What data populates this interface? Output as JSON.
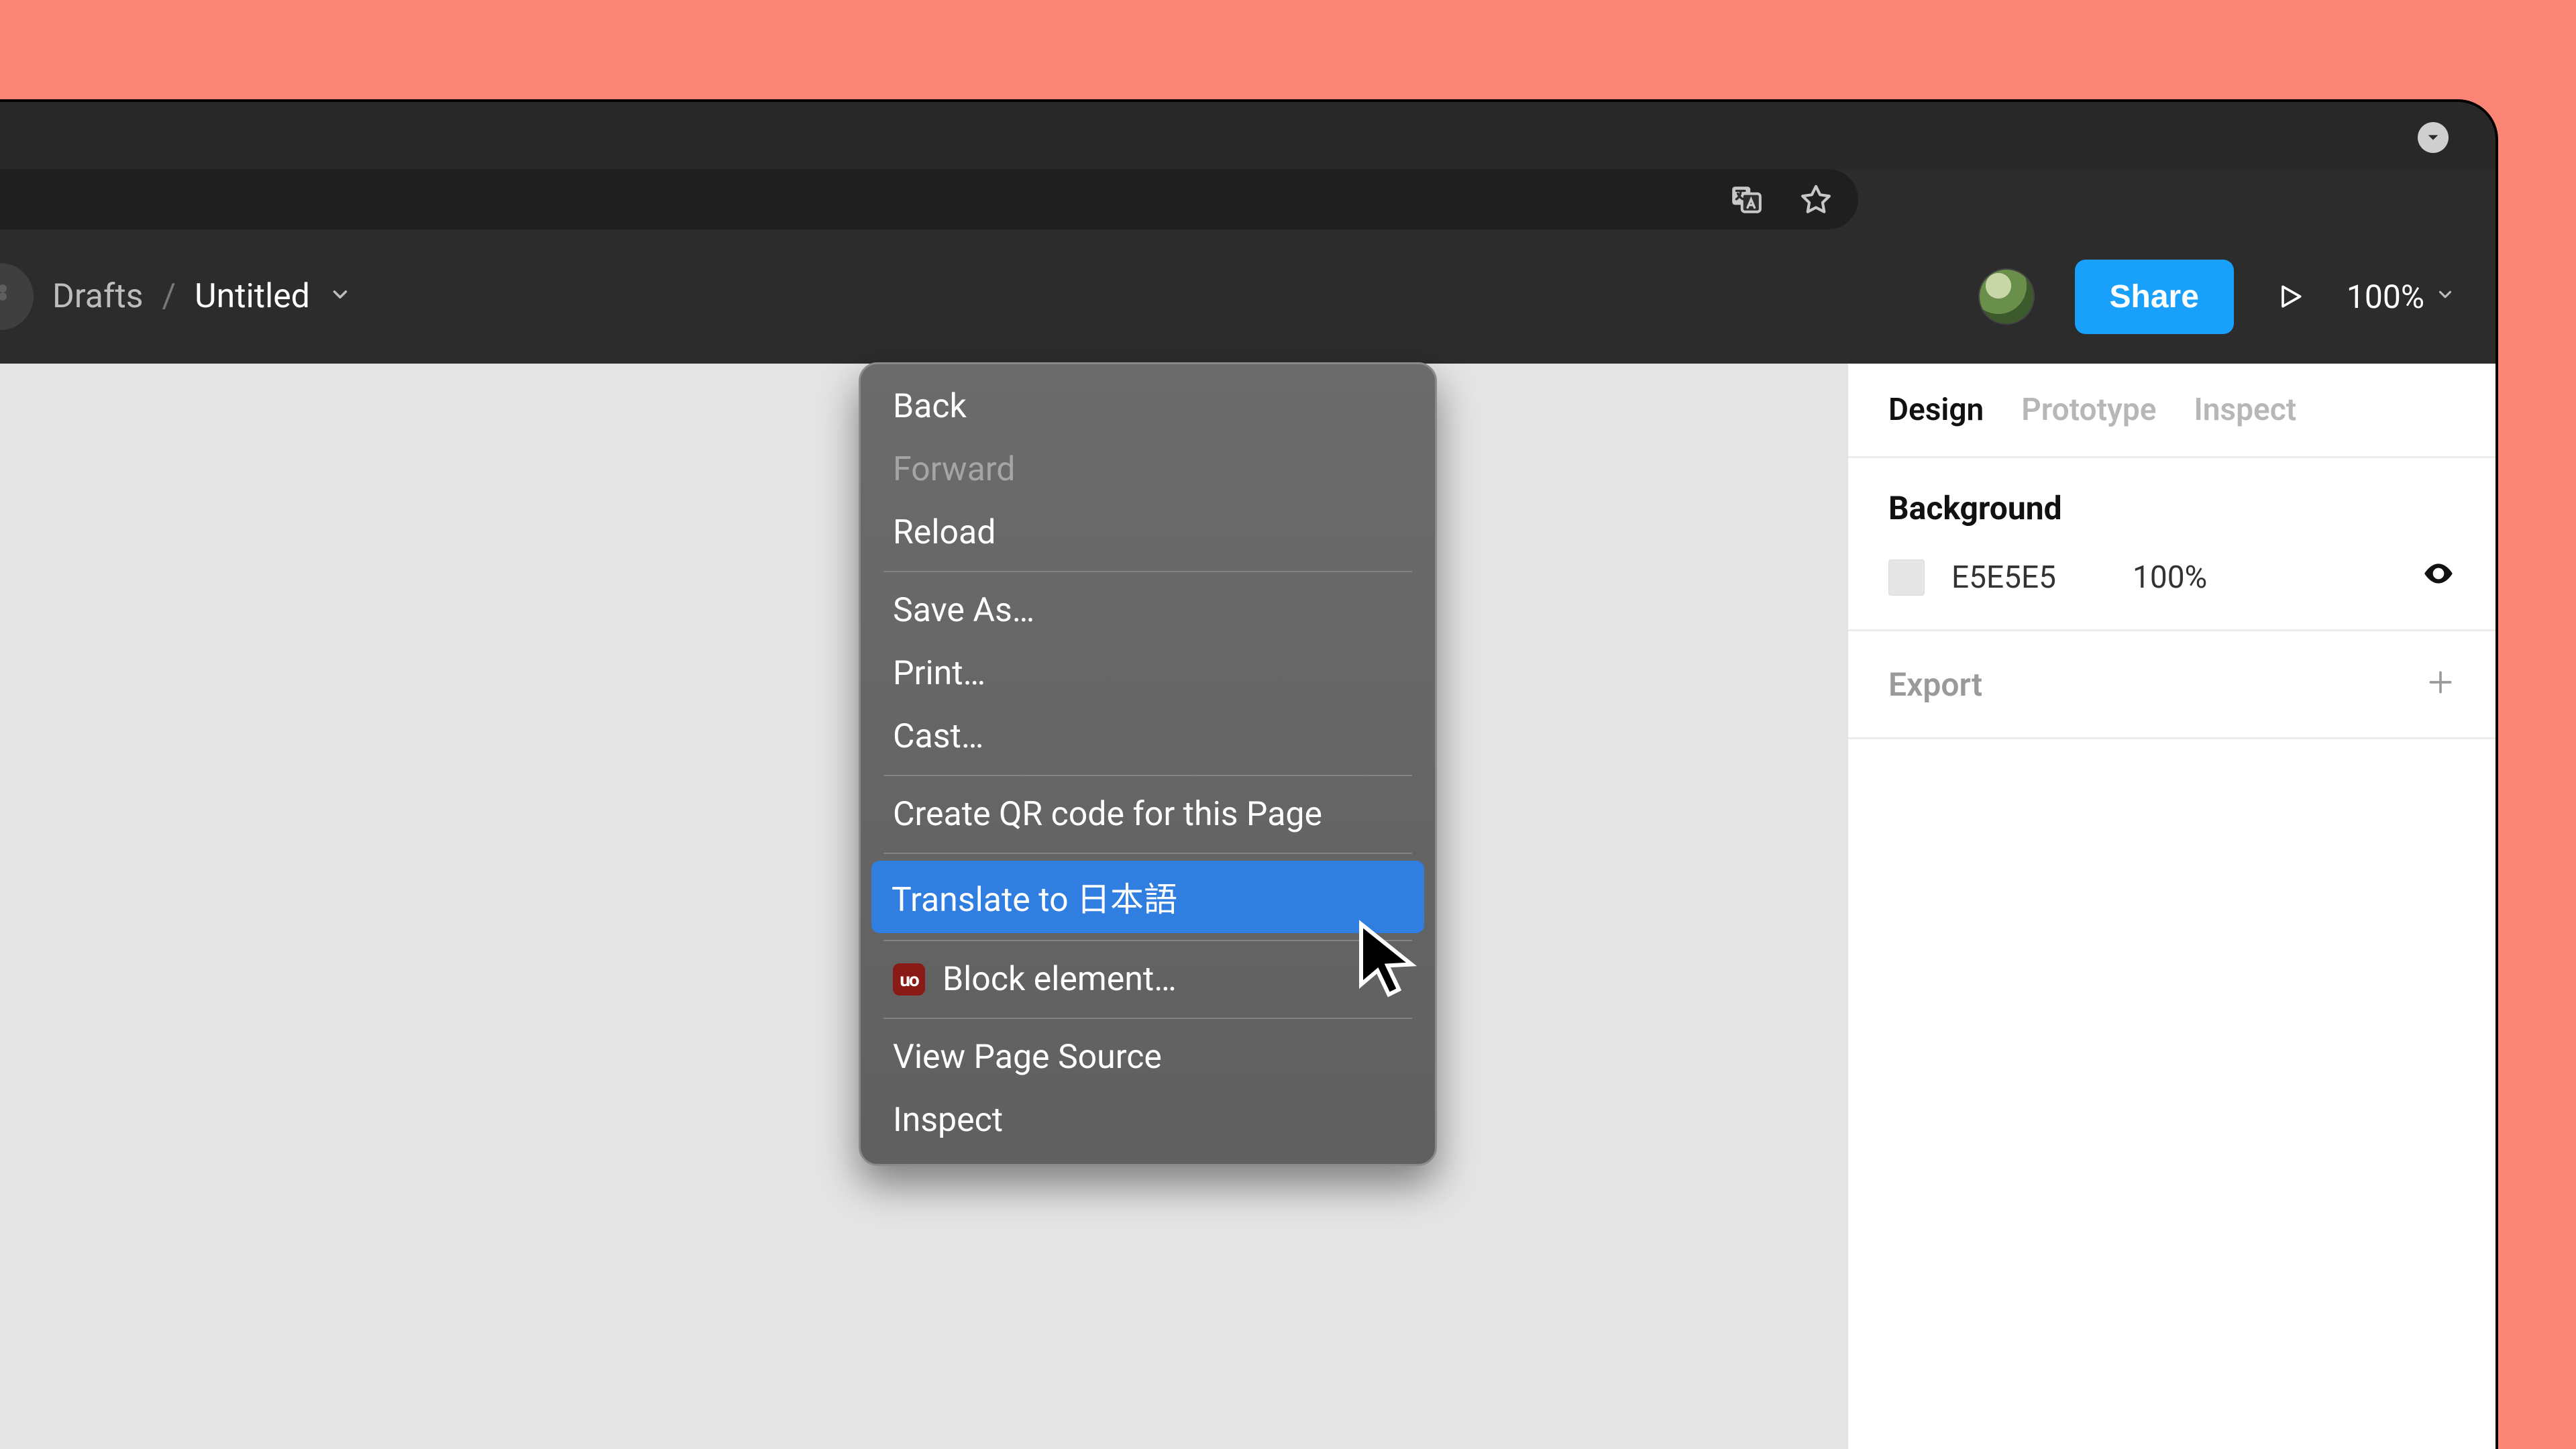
{
  "breadcrumb": {
    "folder": "Drafts",
    "sep": "/",
    "file": "Untitled"
  },
  "toolbar": {
    "share": "Share",
    "zoom": "100%"
  },
  "tabs": {
    "design": "Design",
    "prototype": "Prototype",
    "inspect": "Inspect"
  },
  "panel": {
    "background_title": "Background",
    "bg_hex": "E5E5E5",
    "bg_opacity": "100%",
    "export_title": "Export"
  },
  "context_menu": {
    "back": "Back",
    "forward": "Forward",
    "reload": "Reload",
    "save_as": "Save As…",
    "print": "Print…",
    "cast": "Cast…",
    "qr": "Create QR code for this Page",
    "translate": "Translate to 日本語",
    "block": "Block element…",
    "view_source": "View Page Source",
    "inspect": "Inspect"
  },
  "icons": {
    "ublock": "uo"
  }
}
